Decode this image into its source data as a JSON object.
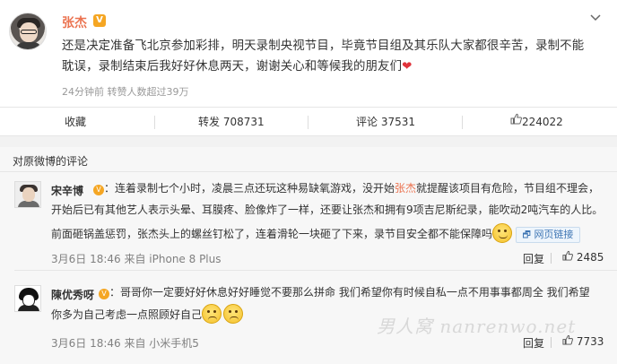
{
  "post": {
    "author": "张杰",
    "verified_badge": "V",
    "menu_icon": "chevron-down-icon",
    "text_line1": "还是决定准备飞北京参加彩排，明天录制央视节目，毕竟节目组及其乐队大家都很辛苦，录制不能",
    "text_line2": "耽误，录制结束后我好好休息两天，谢谢关心和等候我的朋友们",
    "heart": "❤",
    "meta": "24分钟前  转赞人数超过39万"
  },
  "actions": {
    "favorite": "收藏",
    "repost": "转发 708731",
    "comment": "评论 37531",
    "like": "224022",
    "like_icon": "thumbs-up-icon"
  },
  "comments": {
    "title": "对原微博的评论",
    "items": [
      {
        "name": "宋辛博",
        "badge": "V",
        "line1_pre": "：连着录制七个小时，凌晨三点还玩这种易缺氧游戏，没开始",
        "mention": "张杰",
        "line1_post": "就提醒该项目有危险，节目组不理会，",
        "line2": "开始后已有其他艺人表示头晕、耳膜疼、脸像炸了一样，还要让张杰和拥有9项吉尼斯纪录，能吹动2吨汽车的人比。",
        "line3": "前面砸锅盖惩罚，张杰头上的螺丝钉松了，连着滑轮一块砸了下来，录节目安全都不能保障吗",
        "weblink": "网页链接",
        "date": "3月6日 18:46 来自 iPhone 8 Plus",
        "reply": "回复",
        "likes": "2485"
      },
      {
        "name": "陳优秀呀",
        "badge": "V",
        "line1": "：哥哥你一定要好好休息好好睡觉不要那么拼命 我们希望你有时候自私一点不用事事都周全 我们希望",
        "line2": "你多为自己考虑一点照顾好自己",
        "date": "3月6日 18:46 来自 小米手机5",
        "reply": "回复",
        "likes": "7733"
      }
    ]
  },
  "watermark": "男人窝 nanrenwo.net",
  "colors": {
    "accent": "#eb7350",
    "link": "#3f76b4",
    "badge": "#f5a623"
  }
}
